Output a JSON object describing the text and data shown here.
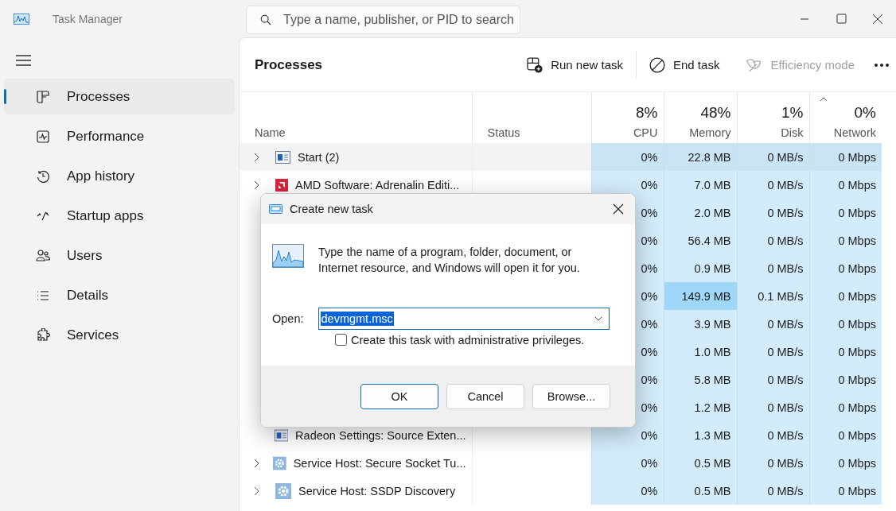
{
  "window": {
    "title": "Task Manager"
  },
  "search": {
    "placeholder": "Type a name, publisher, or PID to search"
  },
  "sidebar": {
    "items": [
      {
        "label": "Processes",
        "kind": "processes",
        "selected": true
      },
      {
        "label": "Performance",
        "kind": "performance",
        "selected": false
      },
      {
        "label": "App history",
        "kind": "history",
        "selected": false
      },
      {
        "label": "Startup apps",
        "kind": "startup",
        "selected": false
      },
      {
        "label": "Users",
        "kind": "users",
        "selected": false
      },
      {
        "label": "Details",
        "kind": "details",
        "selected": false
      },
      {
        "label": "Services",
        "kind": "services",
        "selected": false
      }
    ]
  },
  "page_title": "Processes",
  "toolbar": [
    {
      "label": "Run new task",
      "kind": "run",
      "disabled": false
    },
    {
      "label": "End task",
      "kind": "end",
      "disabled": false
    },
    {
      "label": "Efficiency mode",
      "kind": "leaf",
      "disabled": true
    }
  ],
  "table": {
    "columns": [
      {
        "label": "Name",
        "sorted": false
      },
      {
        "label": "Status",
        "sorted": false
      },
      {
        "label": "CPU",
        "usage": "8%",
        "sorted": false
      },
      {
        "label": "Memory",
        "usage": "48%",
        "sorted": false
      },
      {
        "label": "Disk",
        "usage": "1%",
        "sorted": false
      },
      {
        "label": "Network",
        "usage": "0%",
        "sorted": true
      }
    ],
    "rows": [
      {
        "name": "Start (2)",
        "kind": "window",
        "expandable": true,
        "hovered": true,
        "cpu": "0%",
        "memory": "22.8 MB",
        "disk": "0 MB/s",
        "network": "0 Mbps",
        "memory_hot": false
      },
      {
        "name": "AMD Software: Adrenalin Editi...",
        "kind": "amd",
        "expandable": true,
        "hovered": false,
        "cpu": "0%",
        "memory": "7.0 MB",
        "disk": "0 MB/s",
        "network": "0 Mbps",
        "memory_hot": false
      },
      {
        "hovered": false,
        "cpu": "0%",
        "memory": "2.0 MB",
        "disk": "0 MB/s",
        "network": "0 Mbps",
        "memory_hot": false
      },
      {
        "hovered": false,
        "cpu": "0%",
        "memory": "56.4 MB",
        "disk": "0 MB/s",
        "network": "0 Mbps",
        "memory_hot": false
      },
      {
        "hovered": false,
        "cpu": "0%",
        "memory": "0.9 MB",
        "disk": "0 MB/s",
        "network": "0 Mbps",
        "memory_hot": false
      },
      {
        "hovered": false,
        "cpu": "0%",
        "memory": "149.9 MB",
        "disk": "0.1 MB/s",
        "network": "0 Mbps",
        "memory_hot": true
      },
      {
        "hovered": false,
        "cpu": "0%",
        "memory": "3.9 MB",
        "disk": "0 MB/s",
        "network": "0 Mbps",
        "memory_hot": false
      },
      {
        "hovered": false,
        "cpu": "0%",
        "memory": "1.0 MB",
        "disk": "0 MB/s",
        "network": "0 Mbps",
        "memory_hot": false
      },
      {
        "hovered": false,
        "cpu": "0%",
        "memory": "5.8 MB",
        "disk": "0 MB/s",
        "network": "0 Mbps",
        "memory_hot": false
      },
      {
        "hovered": false,
        "cpu": "0%",
        "memory": "1.2 MB",
        "disk": "0 MB/s",
        "network": "0 Mbps",
        "memory_hot": false
      },
      {
        "name": "Radeon Settings: Source Exten...",
        "kind": "window",
        "expandable": false,
        "hovered": false,
        "cpu": "0%",
        "memory": "1.3 MB",
        "disk": "0 MB/s",
        "network": "0 Mbps",
        "memory_hot": false
      },
      {
        "name": "Service Host: Secure Socket Tu...",
        "kind": "gear",
        "expandable": true,
        "hovered": false,
        "cpu": "0%",
        "memory": "0.5 MB",
        "disk": "0 MB/s",
        "network": "0 Mbps",
        "memory_hot": false
      },
      {
        "name": "Service Host: SSDP Discovery",
        "kind": "gear",
        "expandable": true,
        "hovered": false,
        "cpu": "0%",
        "memory": "0.5 MB",
        "disk": "0 MB/s",
        "network": "0 Mbps",
        "memory_hot": false
      }
    ]
  },
  "dialog": {
    "title": "Create new task",
    "message": "Type the name of a program, folder, document, or Internet resource, and Windows will open it for you.",
    "open_label": "Open:",
    "open_value": "devmgmt.msc",
    "value_selected": true,
    "admin_checkbox": {
      "label": "Create this task with administrative privileges.",
      "checked": false
    },
    "buttons": [
      {
        "label": "OK",
        "default": true
      },
      {
        "label": "Cancel",
        "default": false
      },
      {
        "label": "Browse...",
        "default": false
      }
    ]
  }
}
